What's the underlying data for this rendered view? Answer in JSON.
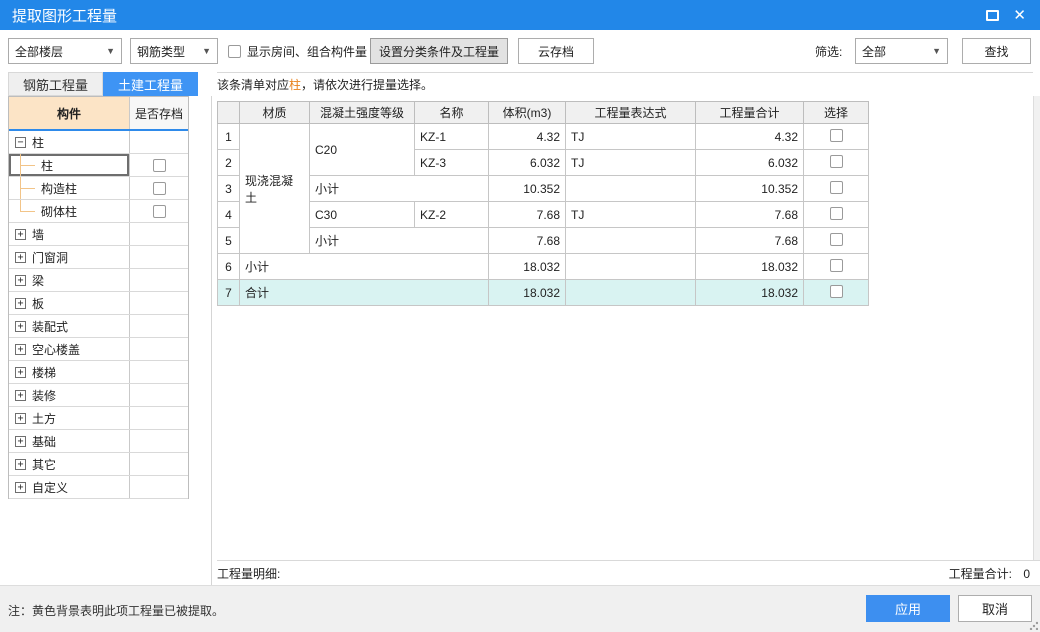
{
  "window": {
    "title": "提取图形工程量"
  },
  "colors": {
    "accent": "#2287E8",
    "tab_active": "#3E94F4",
    "component_header_bg": "#FCE4C6",
    "tree_connector": "#F2C488",
    "total_row_bg": "#D9F3F2",
    "message_highlight": "#E8821E",
    "apply_button": "#3D8FF0"
  },
  "titlebar_icons": {
    "maximize": "maximize-icon",
    "close": "close-icon"
  },
  "toolbar": {
    "floor_dropdown_value": "全部楼层",
    "rebar_type_dropdown_value": "钢筋类型",
    "show_rooms_checkbox_label": "显示房间、组合构件量",
    "show_rooms_checked": false,
    "setup_button_label": "设置分类条件及工程量",
    "cloud_archive_button_label": "云存档",
    "filter_label": "筛选:",
    "filter_dropdown_value": "全部",
    "search_button_label": "查找"
  },
  "tabs": {
    "items": [
      {
        "label": "钢筋工程量",
        "active": false
      },
      {
        "label": "土建工程量",
        "active": true
      }
    ]
  },
  "tree": {
    "headers": {
      "component": "构件",
      "archived": "是否存档"
    },
    "items": [
      {
        "label": "柱",
        "expand": "minus",
        "level": 0,
        "checkbox": false
      },
      {
        "label": "柱",
        "level": 1,
        "checkbox": true,
        "selected": true
      },
      {
        "label": "构造柱",
        "level": 1,
        "checkbox": true
      },
      {
        "label": "砌体柱",
        "level": 1,
        "checkbox": true,
        "last": true
      },
      {
        "label": "墙",
        "expand": "plus",
        "level": 0
      },
      {
        "label": "门窗洞",
        "expand": "plus",
        "level": 0
      },
      {
        "label": "梁",
        "expand": "plus",
        "level": 0
      },
      {
        "label": "板",
        "expand": "plus",
        "level": 0
      },
      {
        "label": "装配式",
        "expand": "plus",
        "level": 0
      },
      {
        "label": "空心楼盖",
        "expand": "plus",
        "level": 0
      },
      {
        "label": "楼梯",
        "expand": "plus",
        "level": 0
      },
      {
        "label": "装修",
        "expand": "plus",
        "level": 0
      },
      {
        "label": "土方",
        "expand": "plus",
        "level": 0
      },
      {
        "label": "基础",
        "expand": "plus",
        "level": 0
      },
      {
        "label": "其它",
        "expand": "plus",
        "level": 0
      },
      {
        "label": "自定义",
        "expand": "plus",
        "level": 0
      }
    ]
  },
  "main": {
    "message": {
      "prefix": "该条清单对应",
      "highlight": "柱",
      "suffix": "，请依次进行提量选择。"
    },
    "table": {
      "headers": [
        "材质",
        "混凝土强度等级",
        "名称",
        "体积(m3)",
        "工程量表达式",
        "工程量合计",
        "选择"
      ],
      "rows": [
        {
          "num": "1",
          "cells": [
            {
              "t": "现浇混凝土",
              "rs": 5,
              "al": "l"
            },
            {
              "t": "C20",
              "rs": 2,
              "al": "l"
            },
            {
              "t": "KZ-1",
              "al": "l"
            },
            {
              "t": "4.32",
              "al": "r"
            },
            {
              "t": "TJ",
              "al": "l"
            },
            {
              "t": "4.32",
              "al": "r"
            },
            {
              "cb": true
            }
          ]
        },
        {
          "num": "2",
          "cells": [
            {
              "t": "KZ-3",
              "al": "l"
            },
            {
              "t": "6.032",
              "al": "r"
            },
            {
              "t": "TJ",
              "al": "l"
            },
            {
              "t": "6.032",
              "al": "r"
            },
            {
              "cb": true
            }
          ]
        },
        {
          "num": "3",
          "cells": [
            {
              "t": "小计",
              "cs": 2,
              "al": "l"
            },
            {
              "t": "10.352",
              "al": "r"
            },
            {
              "t": "",
              "al": "l"
            },
            {
              "t": "10.352",
              "al": "r"
            },
            {
              "cb": true
            }
          ]
        },
        {
          "num": "4",
          "cells": [
            {
              "t": "C30",
              "al": "l"
            },
            {
              "t": "KZ-2",
              "al": "l"
            },
            {
              "t": "7.68",
              "al": "r"
            },
            {
              "t": "TJ",
              "al": "l"
            },
            {
              "t": "7.68",
              "al": "r"
            },
            {
              "cb": true
            }
          ]
        },
        {
          "num": "5",
          "cells": [
            {
              "t": "小计",
              "cs": 2,
              "al": "l"
            },
            {
              "t": "7.68",
              "al": "r"
            },
            {
              "t": "",
              "al": "l"
            },
            {
              "t": "7.68",
              "al": "r"
            },
            {
              "cb": true
            }
          ]
        },
        {
          "num": "6",
          "cells": [
            {
              "t": "小计",
              "cs": 3,
              "al": "l"
            },
            {
              "t": "18.032",
              "al": "r"
            },
            {
              "t": "",
              "al": "l"
            },
            {
              "t": "18.032",
              "al": "r"
            },
            {
              "cb": true
            }
          ]
        },
        {
          "num": "7",
          "hl": true,
          "cells": [
            {
              "t": "合计",
              "cs": 3,
              "al": "l"
            },
            {
              "t": "18.032",
              "al": "r"
            },
            {
              "t": "",
              "al": "l"
            },
            {
              "t": "18.032",
              "al": "r"
            },
            {
              "cb": true
            }
          ]
        }
      ]
    },
    "detail_label": "工程量明细:",
    "total_label": "工程量合计:",
    "total_value": "0"
  },
  "footer": {
    "note": "注：黄色背景表明此项工程量已被提取。",
    "apply_button_label": "应用",
    "cancel_button_label": "取消"
  }
}
